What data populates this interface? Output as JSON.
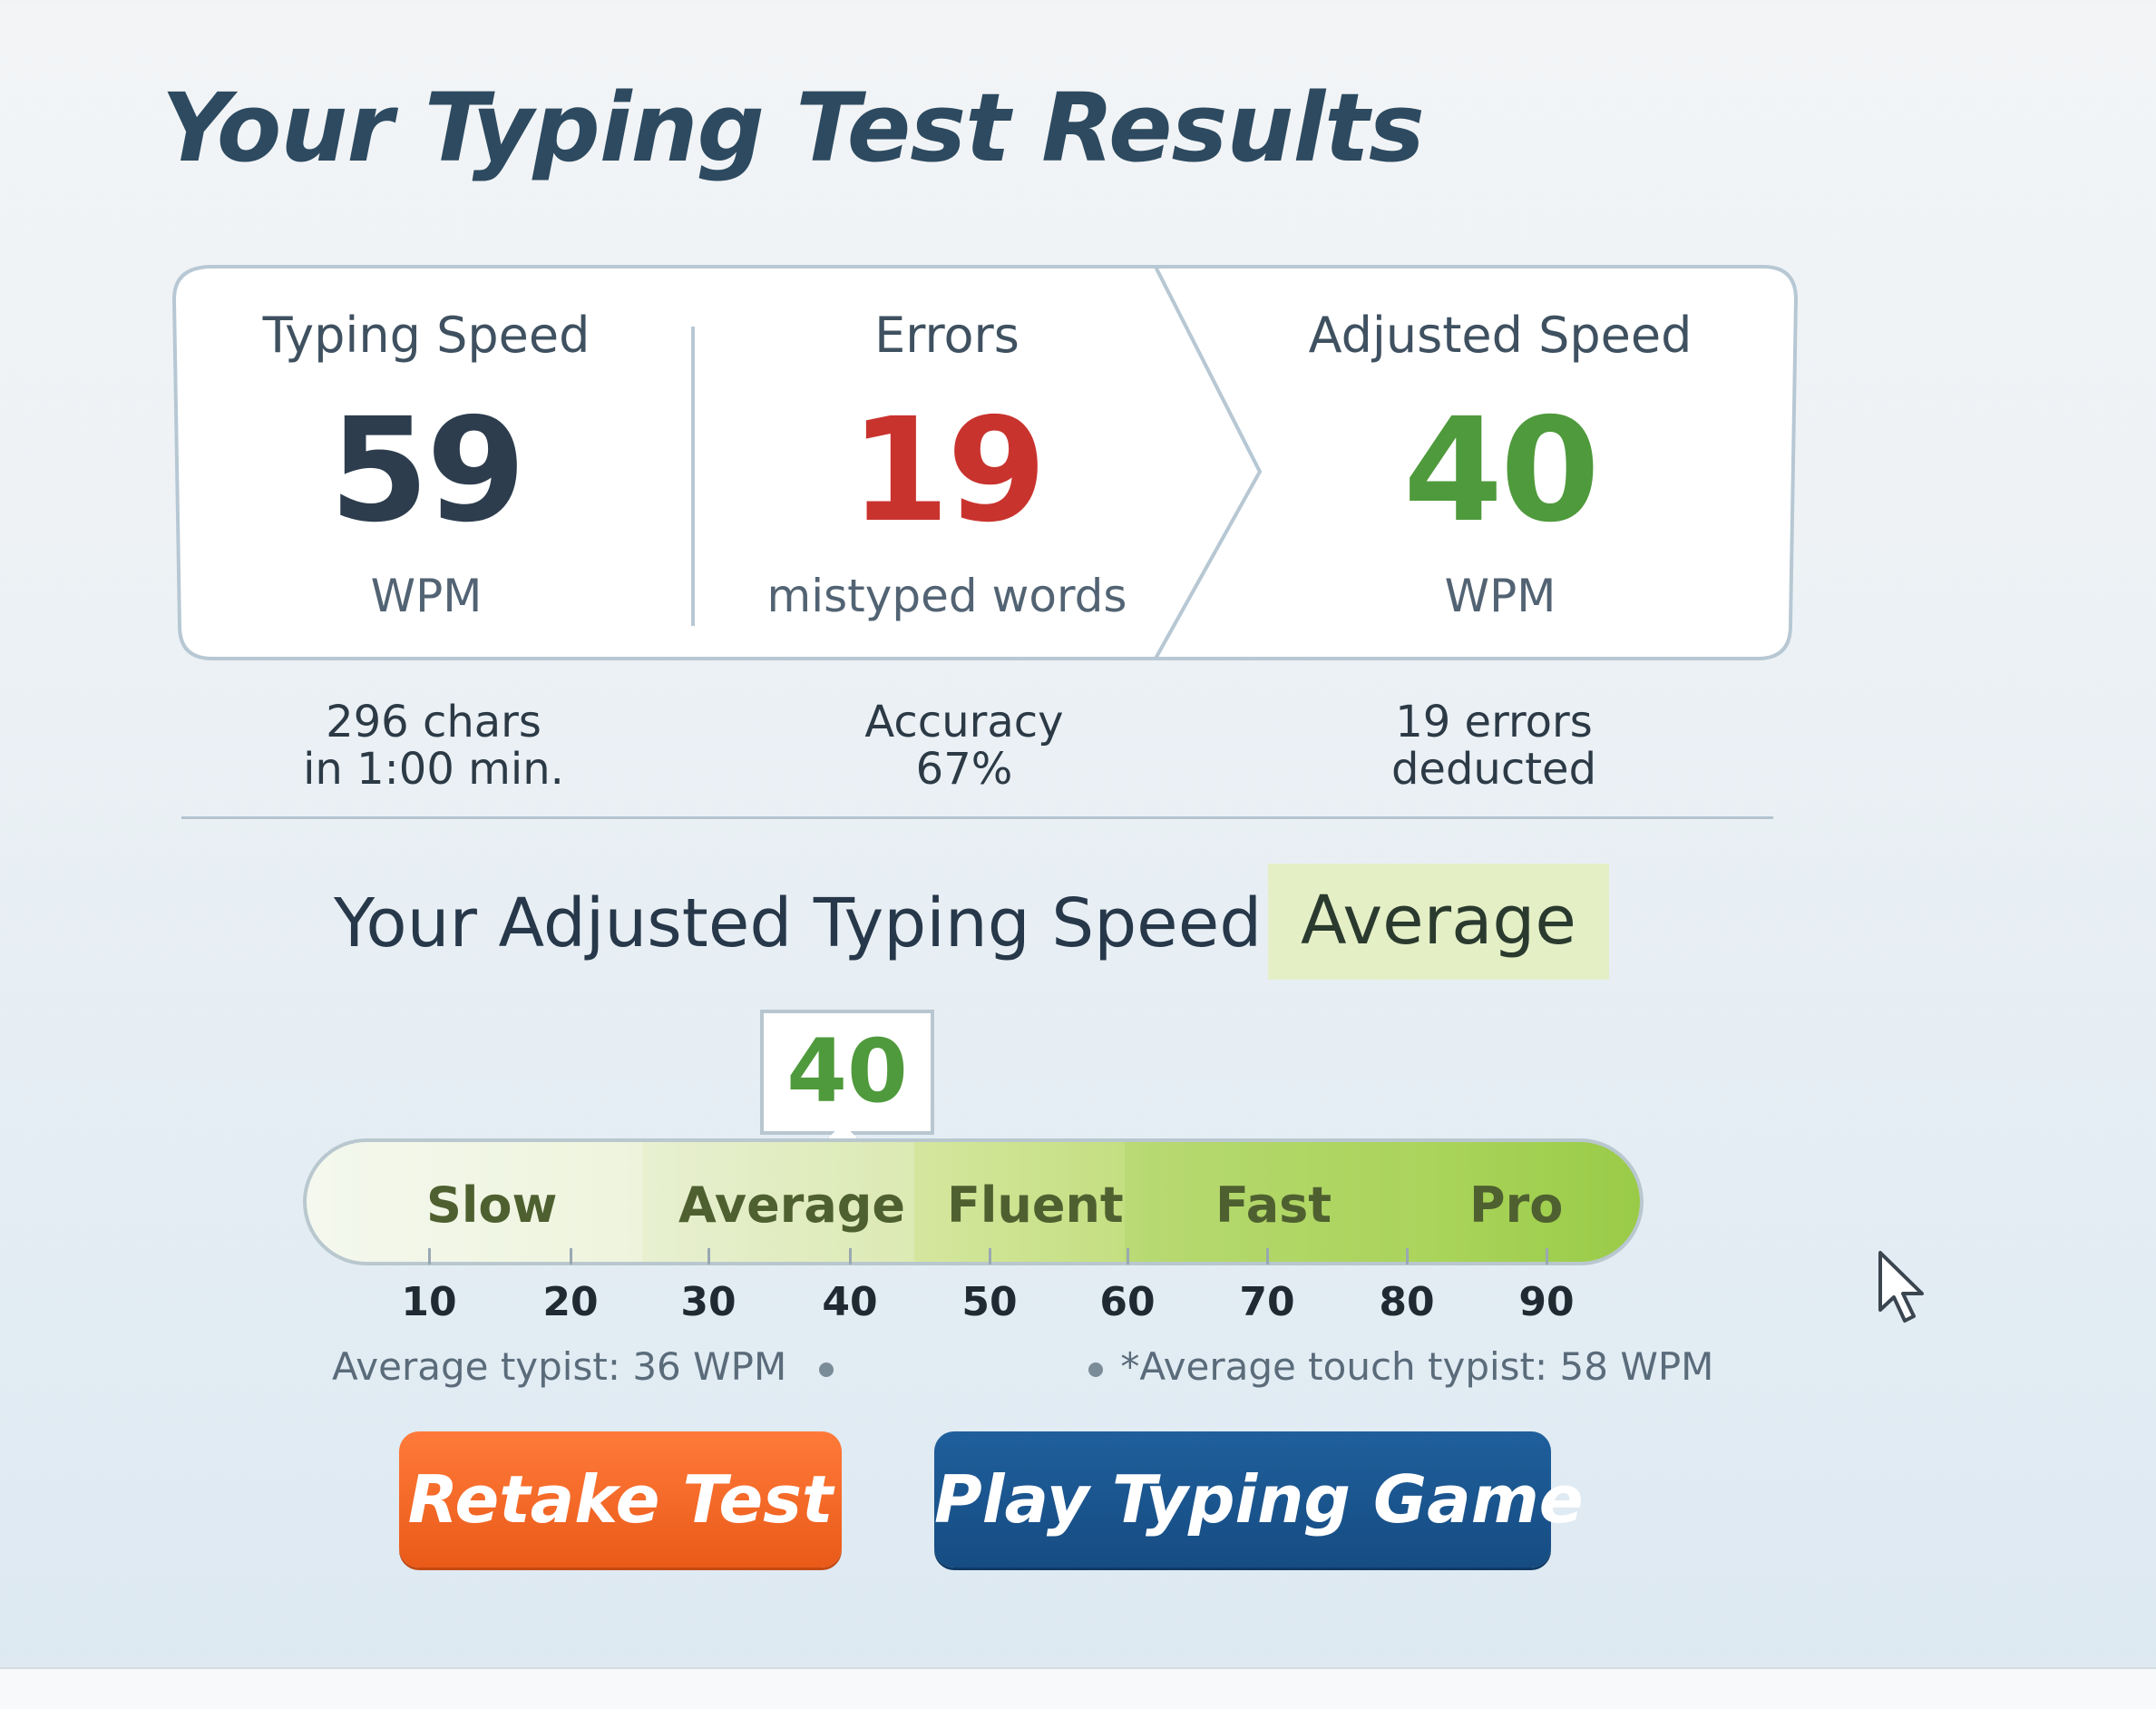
{
  "title": "Your Typing Test Results",
  "stats": {
    "typing_speed": {
      "label": "Typing Speed",
      "value": "59",
      "unit": "WPM",
      "detail_line1": "296 chars",
      "detail_line2": "in 1:00 min."
    },
    "errors": {
      "label": "Errors",
      "value": "19",
      "unit": "mistyped words",
      "detail_line1": "Accuracy",
      "detail_line2": "67%"
    },
    "adjusted_speed": {
      "label": "Adjusted Speed",
      "value": "40",
      "unit": "WPM",
      "detail_line1": "19 errors",
      "detail_line2": "deducted"
    }
  },
  "colors": {
    "speed": "#2d3d4e",
    "errors": "#c9332e",
    "adjusted": "#4f9a3c",
    "retake": "#f26a28",
    "game": "#1a5690"
  },
  "verdict": {
    "text": "Your Adjusted Typing Speed is",
    "level": "Average"
  },
  "scale": {
    "marker_value": "40",
    "segments": [
      "Slow",
      "Average",
      "Fluent",
      "Fast",
      "Pro"
    ],
    "ticks": [
      "10",
      "20",
      "30",
      "40",
      "50",
      "60",
      "70",
      "80",
      "90"
    ],
    "average_typist": "Average typist: 36 WPM",
    "average_touch_typist": "*Average touch typist: 58 WPM"
  },
  "buttons": {
    "retake": "Retake Test",
    "game": "Play Typing Game"
  }
}
